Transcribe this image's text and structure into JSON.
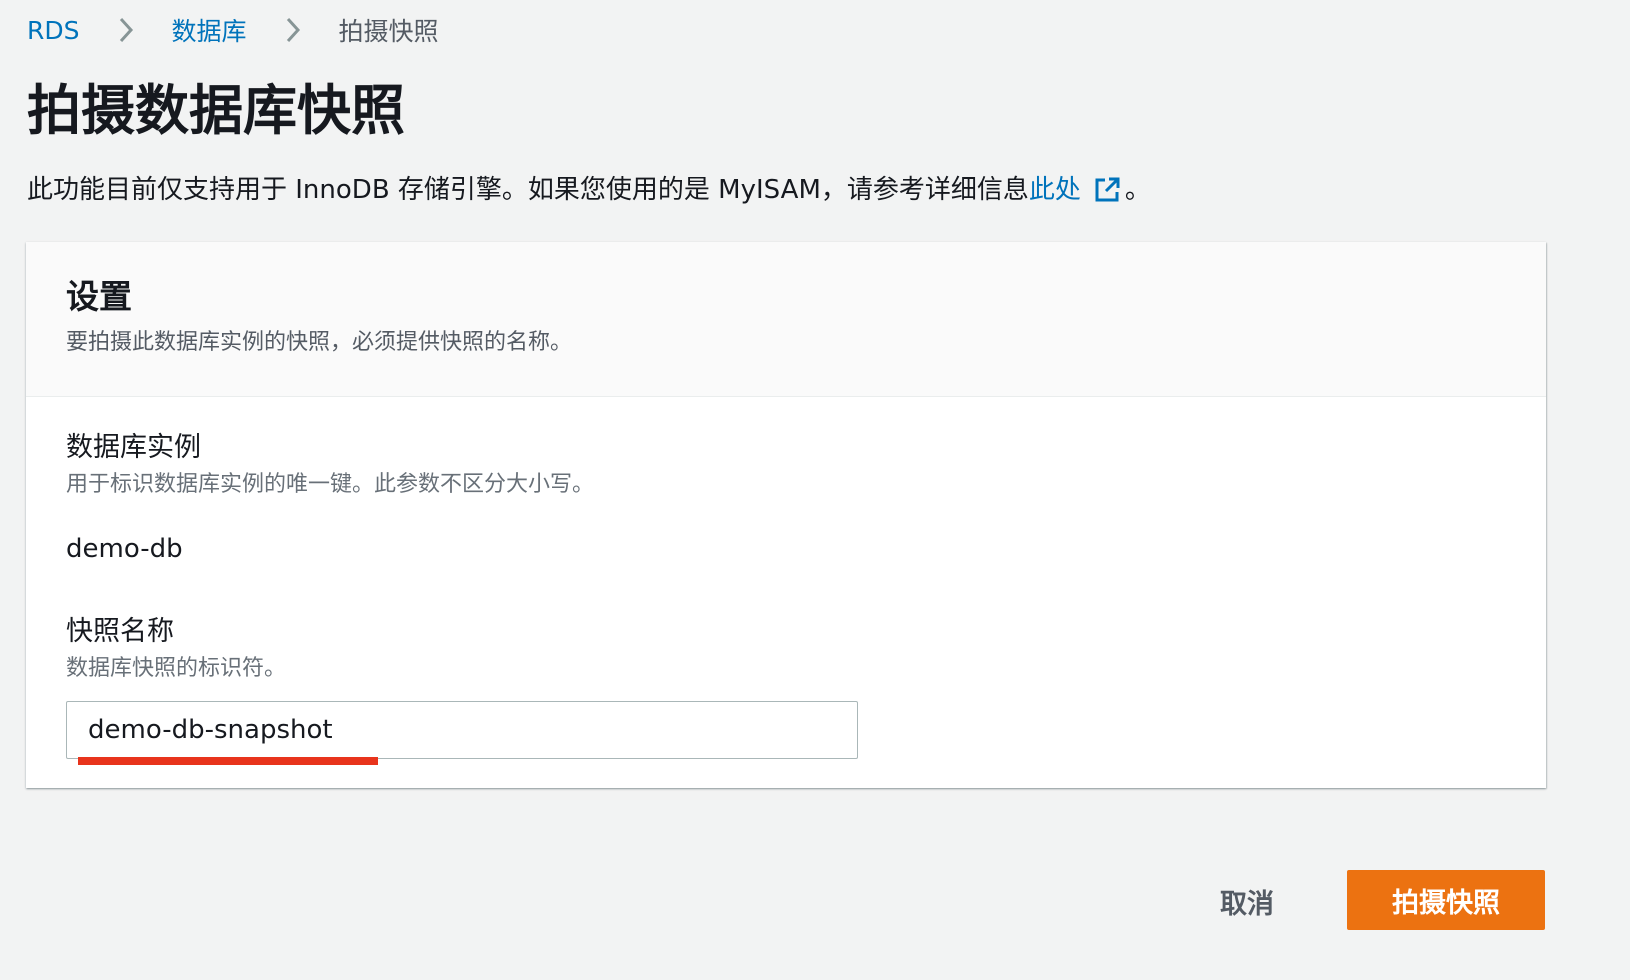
{
  "breadcrumb": {
    "items": [
      {
        "label": "RDS"
      },
      {
        "label": "数据库"
      },
      {
        "label": "拍摄快照"
      }
    ]
  },
  "page": {
    "title": "拍摄数据库快照",
    "info_text": "此功能目前仅支持用于 InnoDB 存储引擎。如果您使用的是 MyISAM，请参考详细信息",
    "info_link": "此处",
    "info_suffix": "。"
  },
  "settings": {
    "title": "设置",
    "description": "要拍摄此数据库实例的快照，必须提供快照的名称。",
    "db_instance": {
      "label": "数据库实例",
      "description": "用于标识数据库实例的唯一键。此参数不区分大小写。",
      "value": "demo-db"
    },
    "snapshot_name": {
      "label": "快照名称",
      "description": "数据库快照的标识符。",
      "value": "demo-db-snapshot"
    }
  },
  "actions": {
    "cancel_label": "取消",
    "submit_label": "拍摄快照"
  },
  "icons": {
    "separator": "chevron-right-icon",
    "external": "external-link-icon"
  },
  "colors": {
    "link": "#0073bb",
    "primary_button": "#ec7211",
    "annotation_underline": "#e8341c",
    "background": "#f2f3f3"
  }
}
